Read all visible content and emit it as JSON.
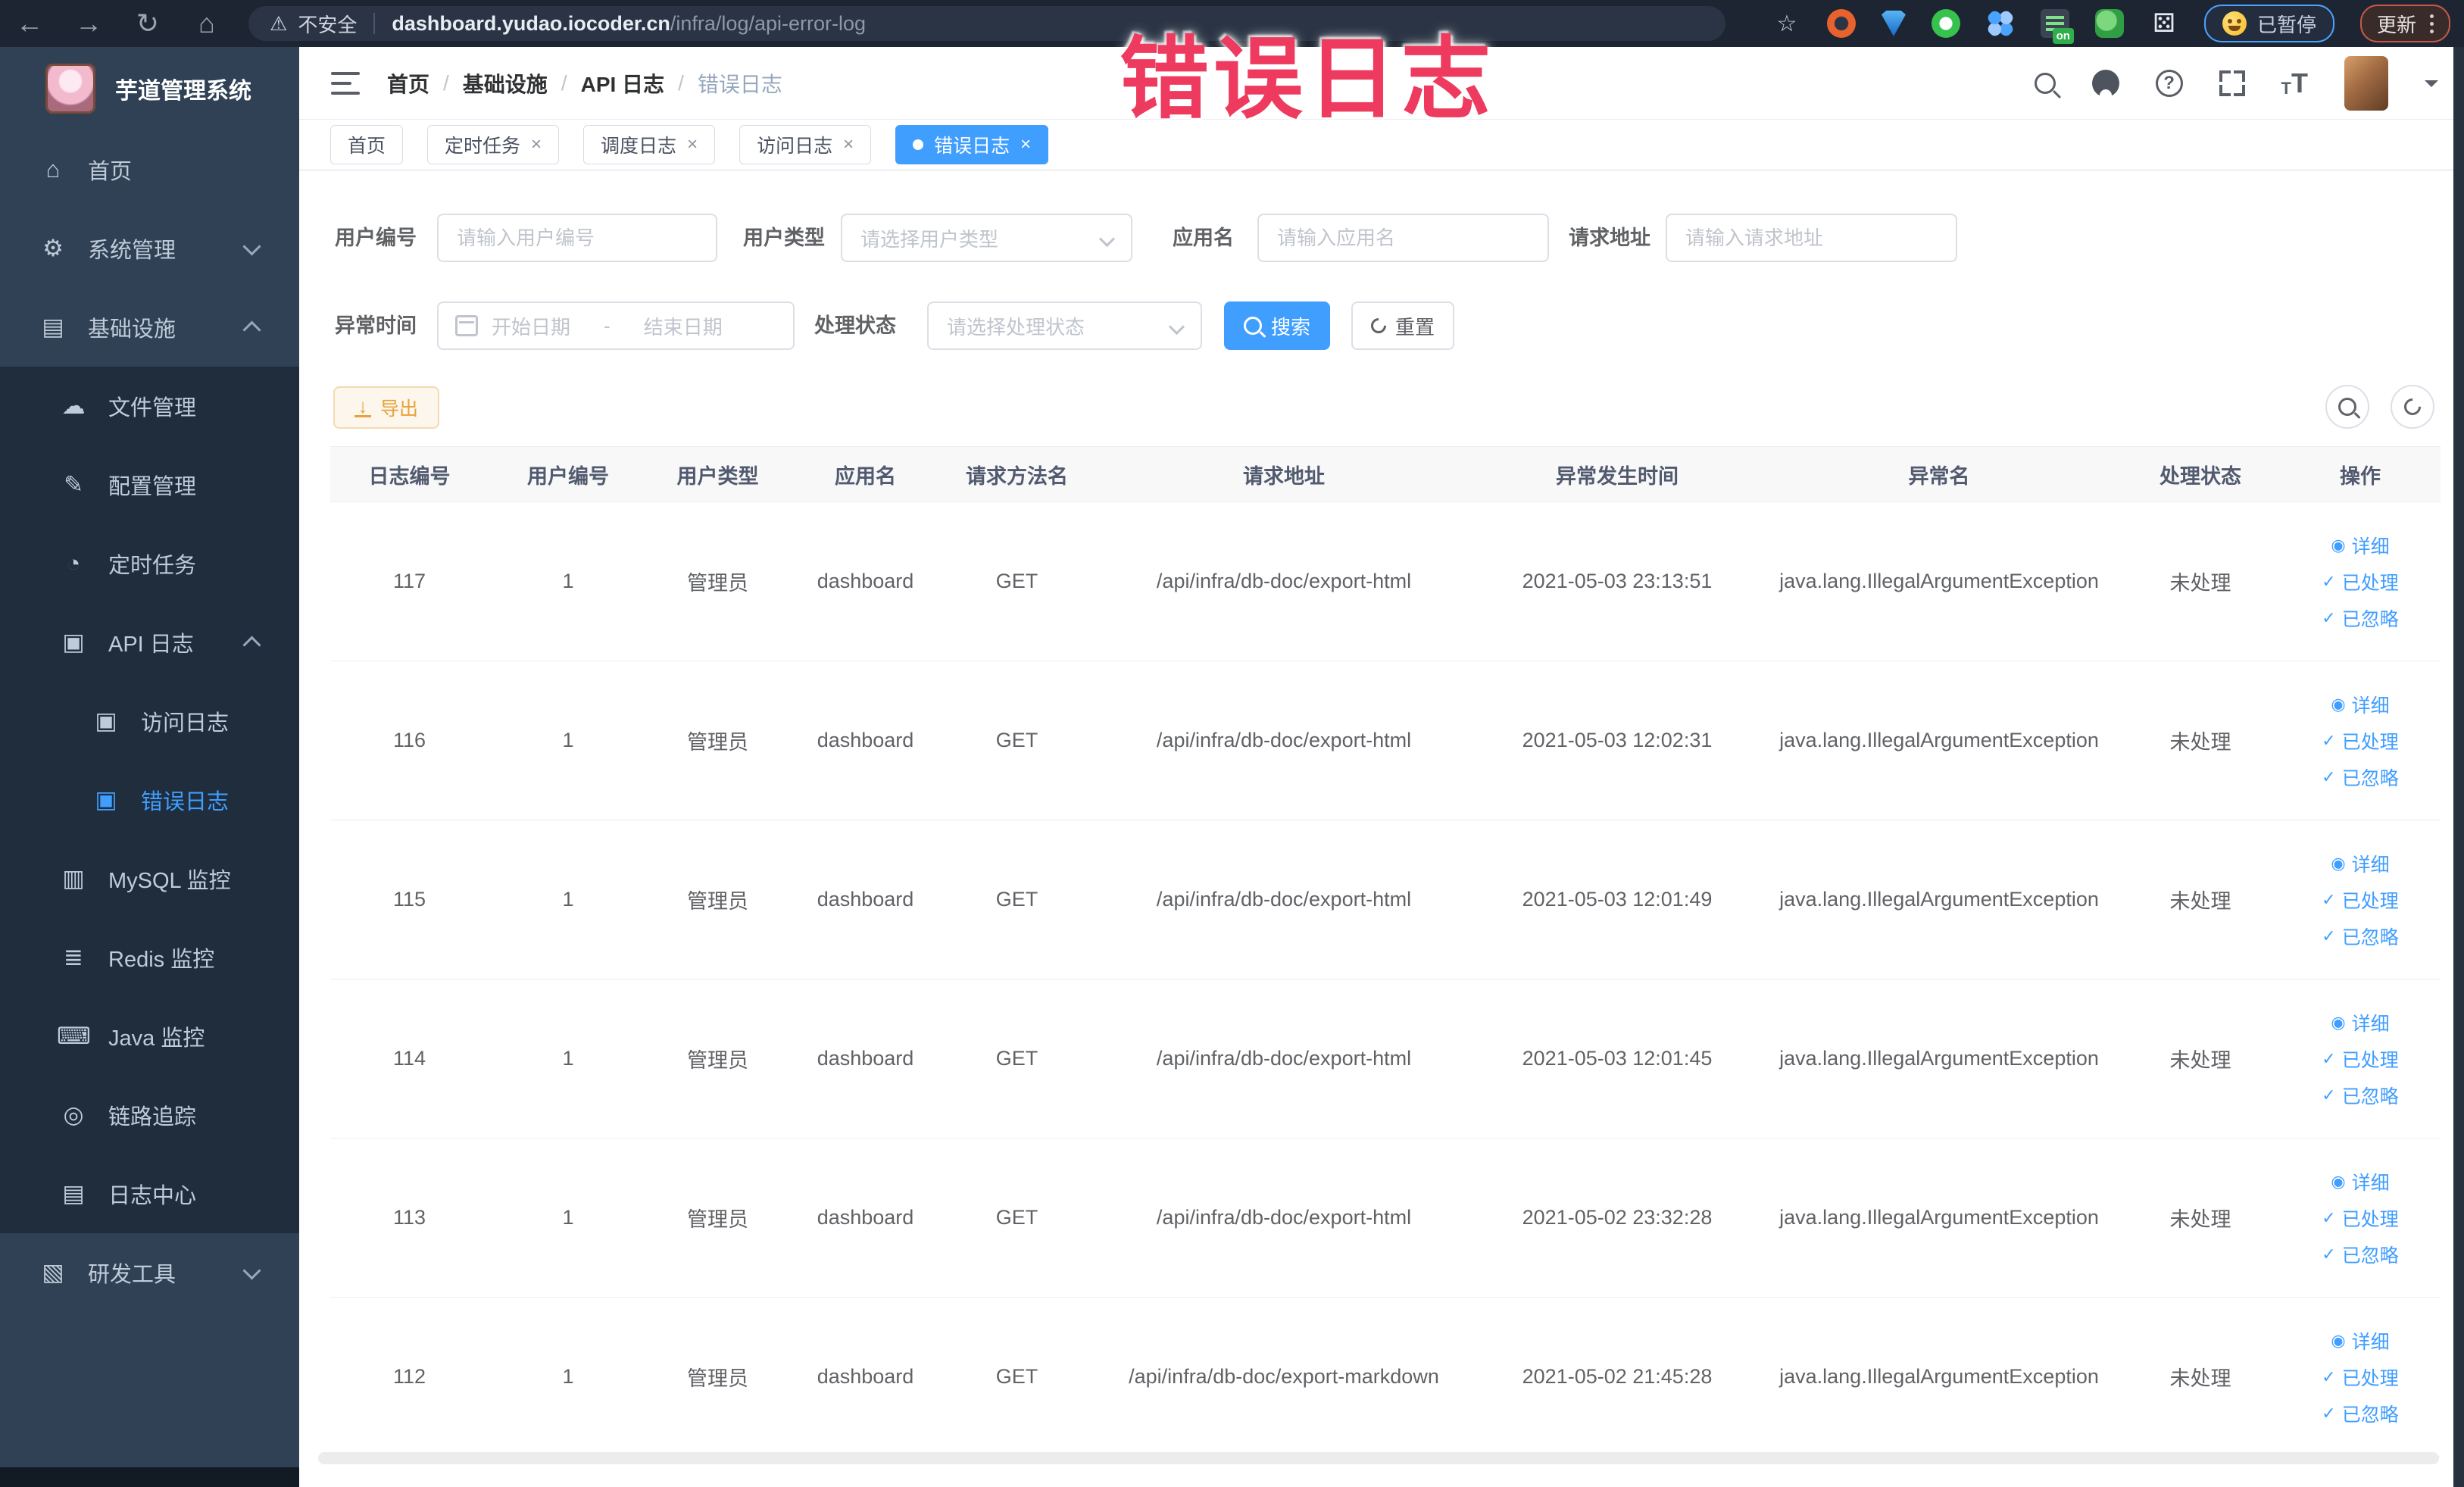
{
  "theme": {
    "accent": "#409eff",
    "warning": "#e6a23c",
    "annotation_pink": "#ee3a5e",
    "sidebar_bg": "#304156",
    "submenu_bg": "#1f2d3d",
    "active_tab_bg": "#409eff"
  },
  "annotation": {
    "text": "错误日志"
  },
  "browser": {
    "security_label": "不安全",
    "url_host": "dashboard.yudao.iocoder.cn",
    "url_path": "/infra/log/api-error-log",
    "paused_label": "已暂停",
    "update_label": "更新",
    "on_badge": "on",
    "nav_icons": [
      "back-icon",
      "forward-icon",
      "reload-icon",
      "home-icon"
    ],
    "nav_glyphs": [
      "←",
      "→",
      "↻",
      "⌂"
    ],
    "extensions": [
      "bookmark-star-icon",
      "circle-extension-icon",
      "shield-extension-icon",
      "ring-extension-icon",
      "grid-extension-icon",
      "panel-on-extension-icon",
      "leaf-extension-icon",
      "puzzle-extensions-icon"
    ]
  },
  "sidebar": {
    "title": "芋道管理系统",
    "items": [
      {
        "label": "首页",
        "icon": "home-menu-icon",
        "glyph": "⌂",
        "level": 1
      },
      {
        "label": "系统管理",
        "icon": "gear-icon",
        "glyph": "⚙",
        "level": 1,
        "chevron": "down"
      },
      {
        "label": "基础设施",
        "icon": "infrastructure-icon",
        "glyph": "▤",
        "level": 1,
        "chevron": "up"
      },
      {
        "label": "文件管理",
        "icon": "file-manage-icon",
        "glyph": "☁",
        "level": 2
      },
      {
        "label": "配置管理",
        "icon": "config-manage-icon",
        "glyph": "✎",
        "level": 2
      },
      {
        "label": "定时任务",
        "icon": "schedule-task-icon",
        "glyph": "◔",
        "level": 2
      },
      {
        "label": "API 日志",
        "icon": "api-log-icon",
        "glyph": "▣",
        "level": 2,
        "chevron": "up"
      },
      {
        "label": "访问日志",
        "icon": "access-log-icon",
        "glyph": "▣",
        "level": 3
      },
      {
        "label": "错误日志",
        "icon": "error-log-icon",
        "glyph": "▣",
        "level": 3,
        "active": true
      },
      {
        "label": "MySQL 监控",
        "icon": "mysql-monitor-icon",
        "glyph": "▥",
        "level": 2
      },
      {
        "label": "Redis 监控",
        "icon": "redis-monitor-icon",
        "glyph": "≣",
        "level": 2
      },
      {
        "label": "Java 监控",
        "icon": "java-monitor-icon",
        "glyph": "⌨",
        "level": 2
      },
      {
        "label": "链路追踪",
        "icon": "trace-icon",
        "glyph": "◎",
        "level": 2
      },
      {
        "label": "日志中心",
        "icon": "log-center-icon",
        "glyph": "▤",
        "level": 2
      },
      {
        "label": "研发工具",
        "icon": "dev-tools-icon",
        "glyph": "▧",
        "level": 1,
        "chevron": "down"
      }
    ]
  },
  "breadcrumb": {
    "separator": "/",
    "items": [
      "首页",
      "基础设施",
      "API 日志",
      "错误日志"
    ]
  },
  "tabs": {
    "close_symbol": "×",
    "items": [
      {
        "label": "首页",
        "closable": false,
        "active": false
      },
      {
        "label": "定时任务",
        "closable": true,
        "active": false
      },
      {
        "label": "调度日志",
        "closable": true,
        "active": false
      },
      {
        "label": "访问日志",
        "closable": true,
        "active": false
      },
      {
        "label": "错误日志",
        "closable": true,
        "active": true
      }
    ]
  },
  "filters": {
    "user_id": {
      "label": "用户编号",
      "placeholder": "请输入用户编号"
    },
    "user_type": {
      "label": "用户类型",
      "placeholder": "请选择用户类型"
    },
    "app_name": {
      "label": "应用名",
      "placeholder": "请输入应用名"
    },
    "request_url": {
      "label": "请求地址",
      "placeholder": "请输入请求地址"
    },
    "exception_time": {
      "label": "异常时间",
      "start_placeholder": "开始日期",
      "separator": "-",
      "end_placeholder": "结束日期"
    },
    "process_status": {
      "label": "处理状态",
      "placeholder": "请选择处理状态"
    },
    "search_label": "搜索",
    "reset_label": "重置"
  },
  "toolbar": {
    "export_label": "导出"
  },
  "table": {
    "columns": [
      "日志编号",
      "用户编号",
      "用户类型",
      "应用名",
      "请求方法名",
      "请求地址",
      "异常发生时间",
      "异常名",
      "处理状态",
      "操作"
    ],
    "actions": [
      "详细",
      "已处理",
      "已忽略"
    ],
    "rows": [
      {
        "id": "117",
        "user_id": "1",
        "user_type": "管理员",
        "app_name": "dashboard",
        "method": "GET",
        "url": "/api/infra/db-doc/export-html",
        "time": "2021-05-03 23:13:51",
        "exception": "java.lang.IllegalArgumentException",
        "status": "未处理"
      },
      {
        "id": "116",
        "user_id": "1",
        "user_type": "管理员",
        "app_name": "dashboard",
        "method": "GET",
        "url": "/api/infra/db-doc/export-html",
        "time": "2021-05-03 12:02:31",
        "exception": "java.lang.IllegalArgumentException",
        "status": "未处理"
      },
      {
        "id": "115",
        "user_id": "1",
        "user_type": "管理员",
        "app_name": "dashboard",
        "method": "GET",
        "url": "/api/infra/db-doc/export-html",
        "time": "2021-05-03 12:01:49",
        "exception": "java.lang.IllegalArgumentException",
        "status": "未处理"
      },
      {
        "id": "114",
        "user_id": "1",
        "user_type": "管理员",
        "app_name": "dashboard",
        "method": "GET",
        "url": "/api/infra/db-doc/export-html",
        "time": "2021-05-03 12:01:45",
        "exception": "java.lang.IllegalArgumentException",
        "status": "未处理"
      },
      {
        "id": "113",
        "user_id": "1",
        "user_type": "管理员",
        "app_name": "dashboard",
        "method": "GET",
        "url": "/api/infra/db-doc/export-html",
        "time": "2021-05-02 23:32:28",
        "exception": "java.lang.IllegalArgumentException",
        "status": "未处理"
      },
      {
        "id": "112",
        "user_id": "1",
        "user_type": "管理员",
        "app_name": "dashboard",
        "method": "GET",
        "url": "/api/infra/db-doc/export-markdown",
        "time": "2021-05-02 21:45:28",
        "exception": "java.lang.IllegalArgumentException",
        "status": "未处理"
      }
    ]
  }
}
